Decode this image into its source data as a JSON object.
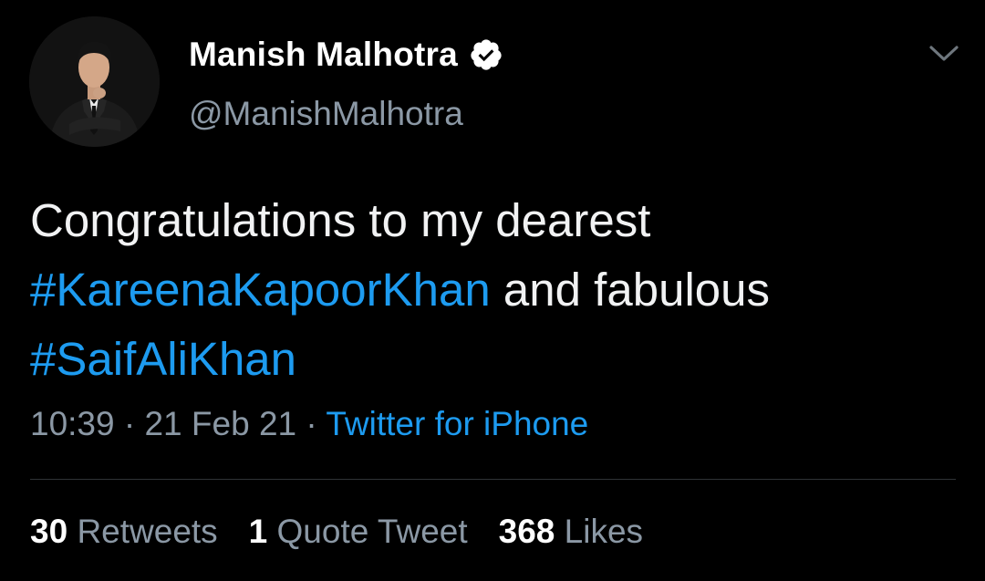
{
  "author": {
    "display_name": "Manish Malhotra",
    "handle": "@ManishMalhotra",
    "verified": true,
    "avatar_icon": "profile-photo"
  },
  "tweet": {
    "line1": "Congratulations to my dearest",
    "hashtag1": "#KareenaKapoorKhan",
    "line2_rest": " and fabulous",
    "hashtag2": "#SaifAliKhan"
  },
  "meta": {
    "time": "10:39",
    "sep1": " · ",
    "date": "21 Feb 21",
    "sep2": " · ",
    "source": "Twitter for iPhone"
  },
  "stats": {
    "retweets_count": "30",
    "retweets_label": "Retweets",
    "quotes_count": "1",
    "quotes_label": "Quote Tweet",
    "likes_count": "368",
    "likes_label": "Likes"
  },
  "colors": {
    "background": "#000000",
    "link": "#1d9bf0",
    "secondary_text": "#8b98a5",
    "primary_text": "#ffffff"
  },
  "icons": {
    "verified": "verified-badge-icon",
    "more": "chevron-down-icon"
  }
}
